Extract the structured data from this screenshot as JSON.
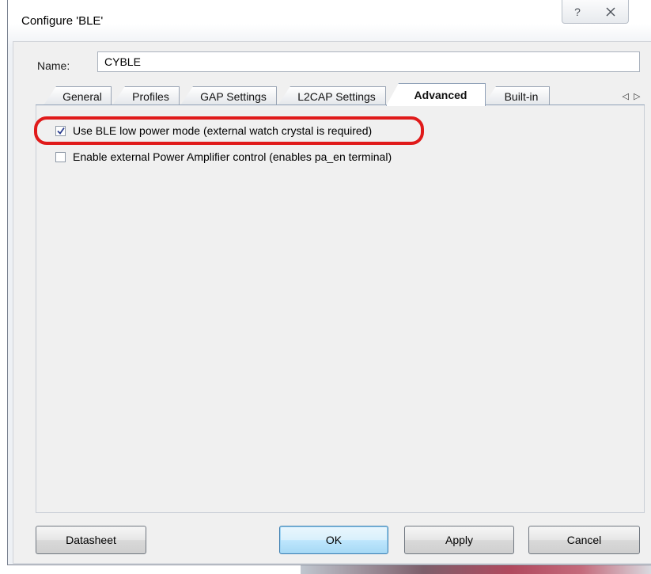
{
  "window": {
    "title": "Configure 'BLE'",
    "help_glyph": "?",
    "close_glyph": "⌧"
  },
  "name_field": {
    "label": "Name:",
    "value": "CYBLE"
  },
  "tabs": [
    {
      "label": "General",
      "active": false
    },
    {
      "label": "Profiles",
      "active": false
    },
    {
      "label": "GAP Settings",
      "active": false
    },
    {
      "label": "L2CAP Settings",
      "active": false
    },
    {
      "label": "Advanced",
      "active": true
    },
    {
      "label": "Built-in",
      "active": false
    }
  ],
  "tab_scroll": {
    "left": "◁",
    "right": "▷"
  },
  "advanced": {
    "options": [
      {
        "label": "Use BLE low power mode (external watch crystal is required)",
        "checked": true
      },
      {
        "label": "Enable external Power Amplifier control (enables pa_en terminal)",
        "checked": false
      }
    ]
  },
  "buttons": {
    "datasheet": "Datasheet",
    "ok": "OK",
    "apply": "Apply",
    "cancel": "Cancel"
  },
  "colors": {
    "highlight": "#e01a1a",
    "ok_button": "#bee6fd",
    "check_mark": "#2a3d8f"
  }
}
